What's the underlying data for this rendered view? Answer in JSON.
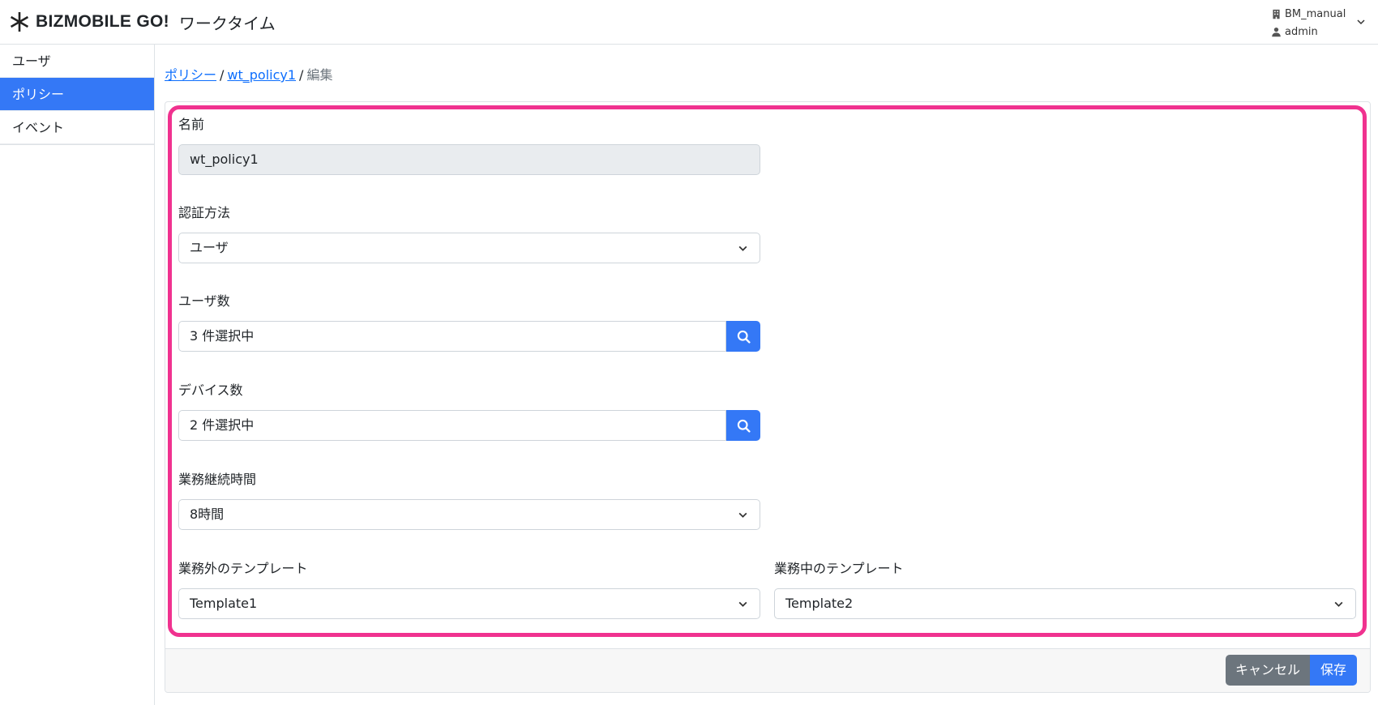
{
  "header": {
    "brand": "BIZMOBILE GO!",
    "app_name": "ワークタイム",
    "organization": "BM_manual",
    "user": "admin",
    "icons": [
      "brand-asterisk-icon",
      "building-icon",
      "user-icon",
      "chevron-down-icon"
    ]
  },
  "sidebar": {
    "items": [
      {
        "label": "ユーザ",
        "active": false
      },
      {
        "label": "ポリシー",
        "active": true
      },
      {
        "label": "イベント",
        "active": false
      }
    ]
  },
  "breadcrumb": {
    "items": [
      {
        "label": "ポリシー",
        "link": true
      },
      {
        "label": "wt_policy1",
        "link": true
      },
      {
        "label": "編集",
        "link": false
      }
    ],
    "separator": "/"
  },
  "form": {
    "name": {
      "label": "名前",
      "value": "wt_policy1"
    },
    "auth_method": {
      "label": "認証方法",
      "value": "ユーザ"
    },
    "user_count": {
      "label": "ユーザ数",
      "value": "3 件選択中"
    },
    "device_count": {
      "label": "デバイス数",
      "value": "2 件選択中"
    },
    "work_duration": {
      "label": "業務継続時間",
      "value": "8時間"
    },
    "offwork_template": {
      "label": "業務外のテンプレート",
      "value": "Template1"
    },
    "onwork_template": {
      "label": "業務中のテンプレート",
      "value": "Template2"
    }
  },
  "footer": {
    "cancel_label": "キャンセル",
    "save_label": "保存"
  },
  "colors": {
    "primary": "#3478f6",
    "secondary": "#6c757d",
    "highlight": "#f0328f",
    "readonly_bg": "#e9ecef"
  }
}
